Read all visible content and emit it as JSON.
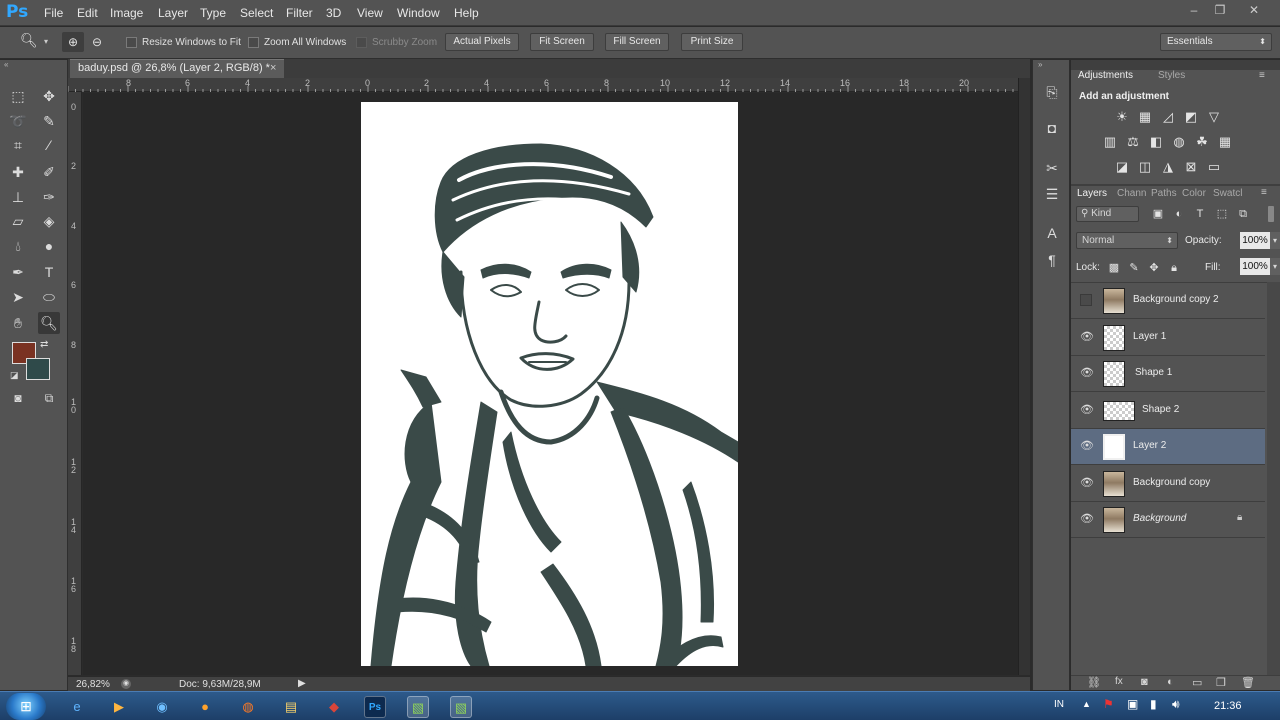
{
  "app": {
    "logo": "Ps"
  },
  "menu": [
    "File",
    "Edit",
    "Image",
    "Layer",
    "Type",
    "Select",
    "Filter",
    "3D",
    "View",
    "Window",
    "Help"
  ],
  "window_controls": {
    "minimize": "–",
    "restore": "❐",
    "close": "✕"
  },
  "options_bar": {
    "resize_windows": "Resize Windows to Fit",
    "zoom_all": "Zoom All Windows",
    "scrubby_zoom": "Scrubby Zoom",
    "actual_pixels": "Actual Pixels",
    "fit_screen": "Fit Screen",
    "fill_screen": "Fill Screen",
    "print_size": "Print Size",
    "workspace": "Essentials"
  },
  "document": {
    "tab_title": "baduy.psd @ 26,8% (Layer 2, RGB/8) *",
    "close": "×",
    "ruler_top": [
      "8",
      "6",
      "4",
      "2",
      "0",
      "2",
      "4",
      "6",
      "8",
      "10",
      "12",
      "14",
      "16",
      "18",
      "20"
    ],
    "ruler_left": [
      "0",
      "2",
      "4",
      "6",
      "8",
      "1\n0",
      "1\n2",
      "1\n4",
      "1\n6",
      "1\n8"
    ],
    "zoom": "26,82%",
    "doc_size": "Doc: 9,63M/28,9M"
  },
  "panels": {
    "adjustments_tab": "Adjustments",
    "styles_tab": "Styles",
    "add_adjustment": "Add an adjustment",
    "layer_tabs": [
      "Layers",
      "Chann",
      "Paths",
      "Color",
      "Swatcl"
    ],
    "filter_kind": "Kind",
    "blend_mode": "Normal",
    "opacity_label": "Opacity:",
    "opacity_value": "100%",
    "lock_label": "Lock:",
    "fill_label": "Fill:",
    "fill_value": "100%"
  },
  "layers": [
    {
      "name": "Background copy 2",
      "visible": false,
      "thumb": "photo"
    },
    {
      "name": "Layer 1",
      "visible": true,
      "thumb": "checker"
    },
    {
      "name": "Shape 1",
      "visible": true,
      "thumb": "checker"
    },
    {
      "name": "Shape 2",
      "visible": true,
      "thumb": "checker"
    },
    {
      "name": "Layer 2",
      "visible": true,
      "thumb": "white",
      "selected": true
    },
    {
      "name": "Background copy",
      "visible": true,
      "thumb": "photo"
    },
    {
      "name": "Background",
      "visible": true,
      "thumb": "photo",
      "locked": true
    }
  ],
  "taskbar": {
    "lang": "IN",
    "time": "21:36"
  },
  "colors": {
    "foreground": "#7a3222",
    "background": "#2f4a4a",
    "line_art": "#3a4a48",
    "selected_layer": "#5d6c82"
  }
}
